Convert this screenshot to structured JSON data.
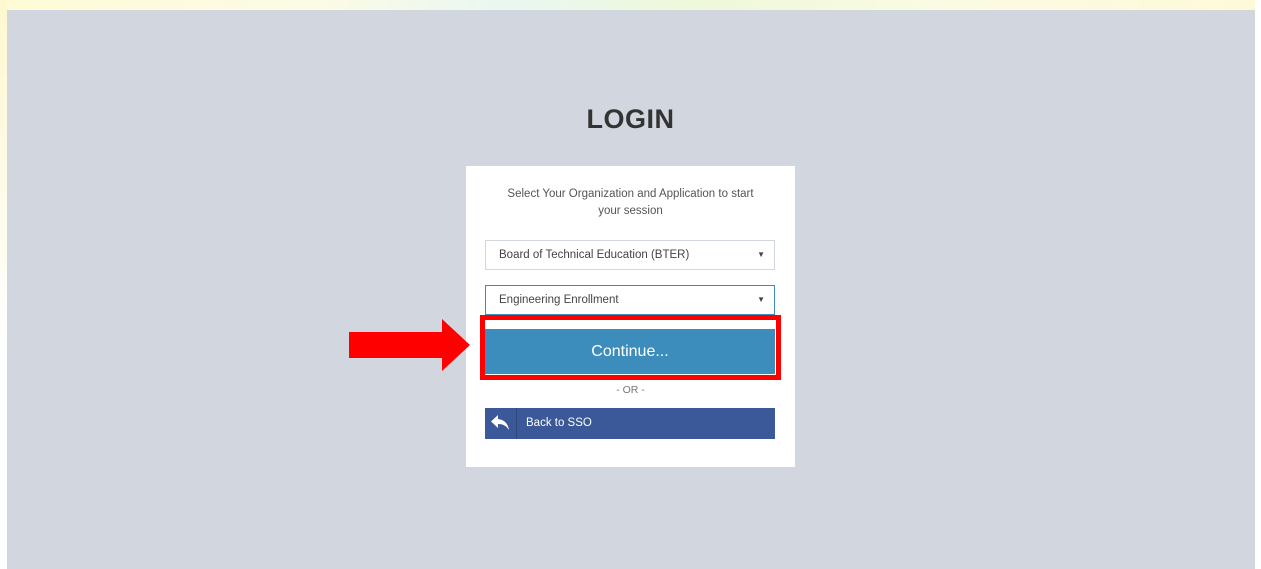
{
  "page": {
    "title": "LOGIN",
    "intro": "Select Your Organization and Application to start your session"
  },
  "form": {
    "organization_value": "Board of Technical Education (BTER)",
    "application_value": "Engineering Enrollment",
    "continue_label": "Continue...",
    "or_text": "- OR -",
    "back_label": "Back to SSO"
  },
  "annotation": {
    "highlight_color": "#ff0000",
    "arrow_color": "#ff0000"
  },
  "colors": {
    "background": "#d2d6de",
    "primary": "#3c8dbc",
    "sso": "#3b5998"
  }
}
